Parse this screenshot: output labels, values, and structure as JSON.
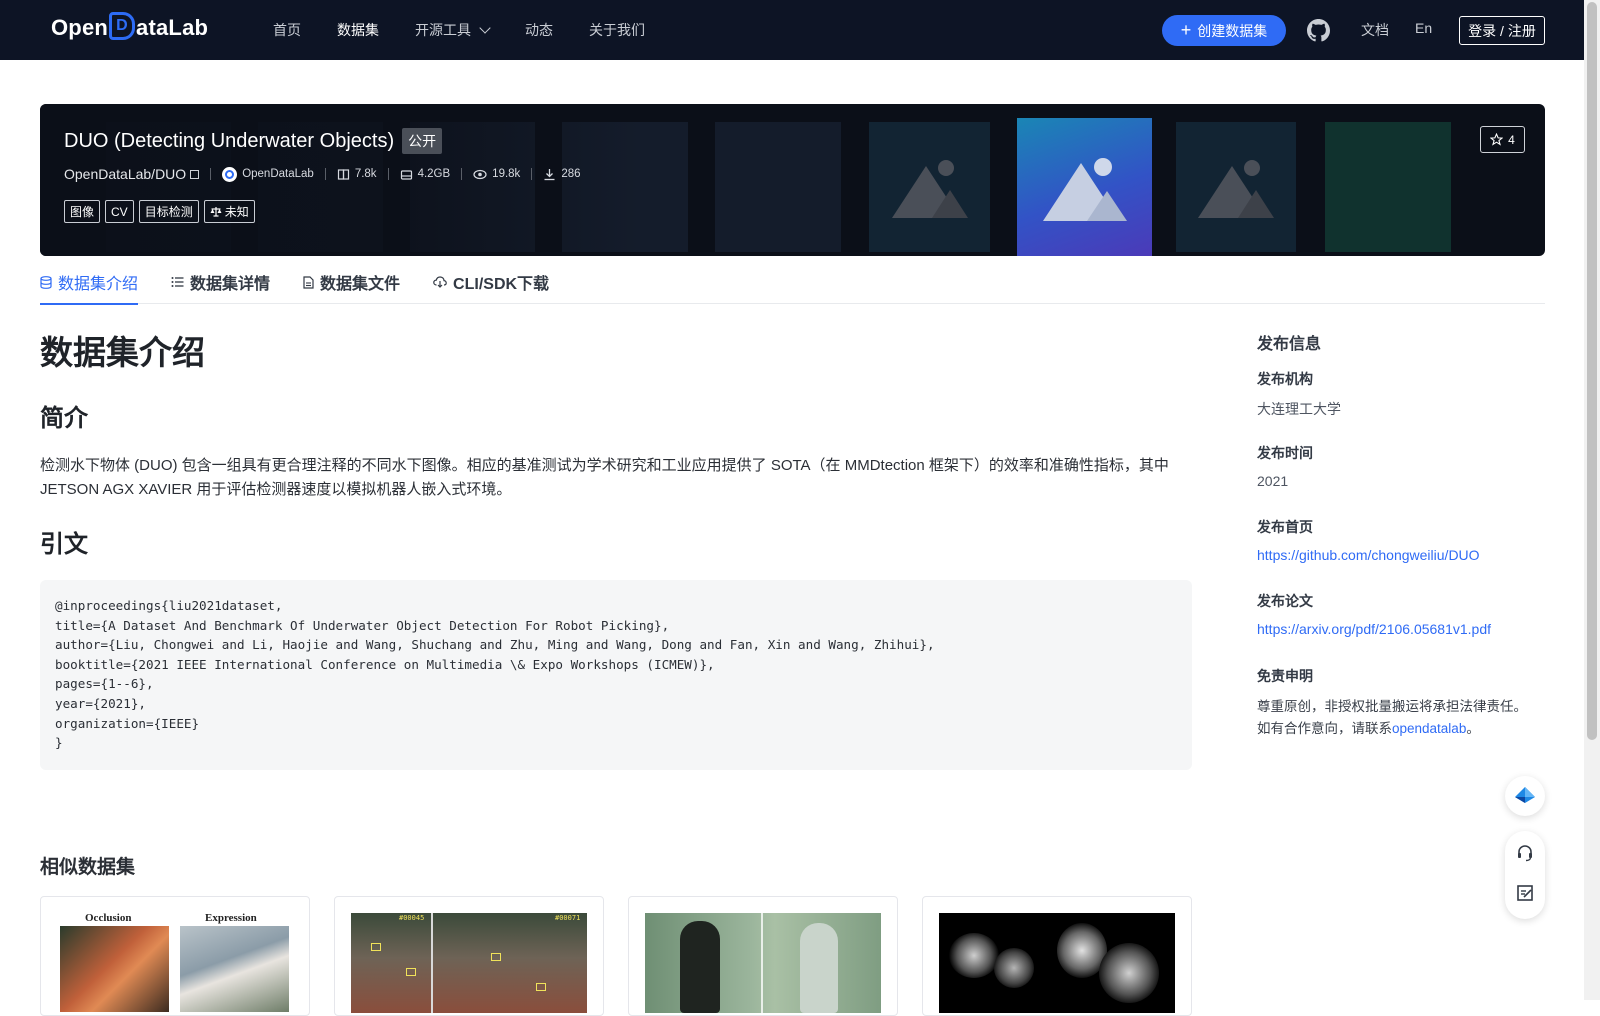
{
  "nav": {
    "logo_pre": "Open",
    "logo_d": "D",
    "logo_post": "ataLab",
    "links": [
      "首页",
      "数据集",
      "开源工具",
      "动态",
      "关于我们"
    ],
    "create_label": "创建数据集",
    "doc_label": "文档",
    "lang_label": "En",
    "login_label": "登录 / 注册"
  },
  "hero": {
    "title": "DUO (Detecting Underwater Objects)",
    "visibility": "公开",
    "repo": "OpenDataLab/DUO",
    "org": "OpenDataLab",
    "stats": {
      "files": "7.8k",
      "size": "4.2GB",
      "views": "19.8k",
      "downloads": "286"
    },
    "tags": [
      "图像",
      "CV",
      "目标检测",
      "未知"
    ],
    "stars": "4"
  },
  "tabs": [
    "数据集介绍",
    "数据集详情",
    "数据集文件",
    "CLI/SDK下载"
  ],
  "main": {
    "heading": "数据集介绍",
    "intro_heading": "简介",
    "intro_text": "检测水下物体 (DUO) 包含一组具有更合理注释的不同水下图像。相应的基准测试为学术研究和工业应用提供了 SOTA（在 MMDtection 框架下）的效率和准确性指标，其中 JETSON AGX XAVIER 用于评估检测器速度以模拟机器人嵌入式环境。",
    "citation_heading": "引文",
    "citation": "@inproceedings{liu2021dataset,\ntitle={A Dataset And Benchmark Of Underwater Object Detection For Robot Picking},\nauthor={Liu, Chongwei and Li, Haojie and Wang, Shuchang and Zhu, Ming and Wang, Dong and Fan, Xin and Wang, Zhihui},\nbooktitle={2021 IEEE International Conference on Multimedia \\& Expo Workshops (ICMEW)},\npages={1--6},\nyear={2021},\norganization={IEEE}\n}",
    "similar_heading": "相似数据集",
    "similar_cards": [
      {
        "caption_left": "Occlusion",
        "caption_right": "Expression"
      },
      {
        "caption_left": "#00045",
        "caption_right": "#00071"
      },
      {},
      {}
    ]
  },
  "sidebar": {
    "title": "发布信息",
    "org_label": "发布机构",
    "org_value": "大连理工大学",
    "time_label": "发布时间",
    "time_value": "2021",
    "home_label": "发布首页",
    "home_link": "https://github.com/chongweiliu/DUO",
    "paper_label": "发布论文",
    "paper_link": "https://arxiv.org/pdf/2106.05681v1.pdf",
    "disclaimer_label": "免责申明",
    "disclaimer_line1": "尊重原创，非授权批量搬运将承担法律责任。",
    "disclaimer_line2": "如有合作意向，请联系",
    "disclaimer_contact": "opendatalab",
    "disclaimer_end": "。"
  },
  "colors": {
    "nav_bg": "#0d1425",
    "accent": "#2f6bf5",
    "hero_bg": "#0b0f18",
    "code_bg": "#f5f6f7"
  },
  "icons": {
    "create": "plus-icon",
    "github": "github-icon",
    "star": "star-icon",
    "files": "file-stack-icon",
    "size": "disk-icon",
    "views": "eye-icon",
    "downloads": "download-icon",
    "license": "scale-icon",
    "copy": "copy-icon",
    "tab_intro": "database-icon",
    "tab_details": "list-icon",
    "tab_files": "file-icon",
    "tab_cli": "cloud-download-icon",
    "float_top": "paper-plane-icon",
    "float_support": "headset-icon",
    "float_feedback": "edit-note-icon"
  }
}
